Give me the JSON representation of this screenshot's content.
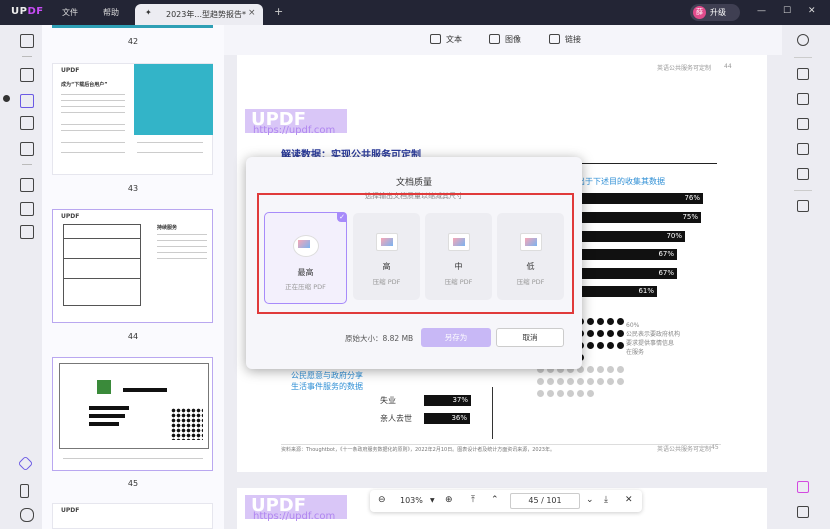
{
  "app": {
    "brand_up": "UP",
    "brand_df": "DF",
    "menu": [
      "文件",
      "帮助"
    ]
  },
  "tab": {
    "title": "2023年...型趋势报告*",
    "new_tab": "+"
  },
  "user": {
    "avatar": "薛",
    "upgrade": "升级"
  },
  "window": {
    "minimize": "—",
    "maximize": "☐",
    "close": "✕"
  },
  "thumbnails": {
    "pages": [
      "42",
      "43",
      "44",
      "45"
    ],
    "p43_title": "成为“下载后台用户”",
    "p44_title": "持续服务"
  },
  "content_toolbar": {
    "text": "文本",
    "image": "图像",
    "link": "链接"
  },
  "page_top": {
    "header": "英语公共服务可定制",
    "num": "44"
  },
  "page_main": {
    "watermark": "https://updf.com",
    "heading": "解读数据：实现公共服务可定制",
    "right_caption": "出于下述目的收集其数据",
    "bars": [
      {
        "label": "76%"
      },
      {
        "label": "75%"
      },
      {
        "label": "70%"
      },
      {
        "label": "67%"
      },
      {
        "label": "67%"
      },
      {
        "label": "61%"
      }
    ],
    "legend": [
      "60%",
      "公民表示要政府机构",
      "要求提供事情信息",
      "在服务"
    ],
    "left_blue": [
      "公民愿意与政府分享",
      "生活事件服务的数据"
    ],
    "rows": [
      {
        "label": "失业",
        "value": "37%"
      },
      {
        "label": "亲人去世",
        "value": "36%"
      }
    ],
    "footnote": "资料来源：Thoughtbot，《十一条政府服务数据化的原则》，2022年2月10日。图表设计者及统计方面资讯来源，2023年。",
    "footer": "英语公共服务可定制",
    "page": "45",
    "logo": "UPDF"
  },
  "dialog": {
    "title": "文档质量",
    "subtitle": "选择输出文档质量以缩减其尺寸",
    "options": [
      {
        "label": "最高",
        "desc": "正在压缩 PDF"
      },
      {
        "label": "高",
        "desc": "压缩 PDF"
      },
      {
        "label": "中",
        "desc": "压缩 PDF"
      },
      {
        "label": "低",
        "desc": "压缩 PDF"
      }
    ],
    "original_size": "原始大小：8.82 MB",
    "save_as": "另存为",
    "cancel": "取消",
    "check": "✓"
  },
  "navbar": {
    "zoom": "103%",
    "page_current": "45",
    "page_sep": "/",
    "page_total": "101"
  }
}
